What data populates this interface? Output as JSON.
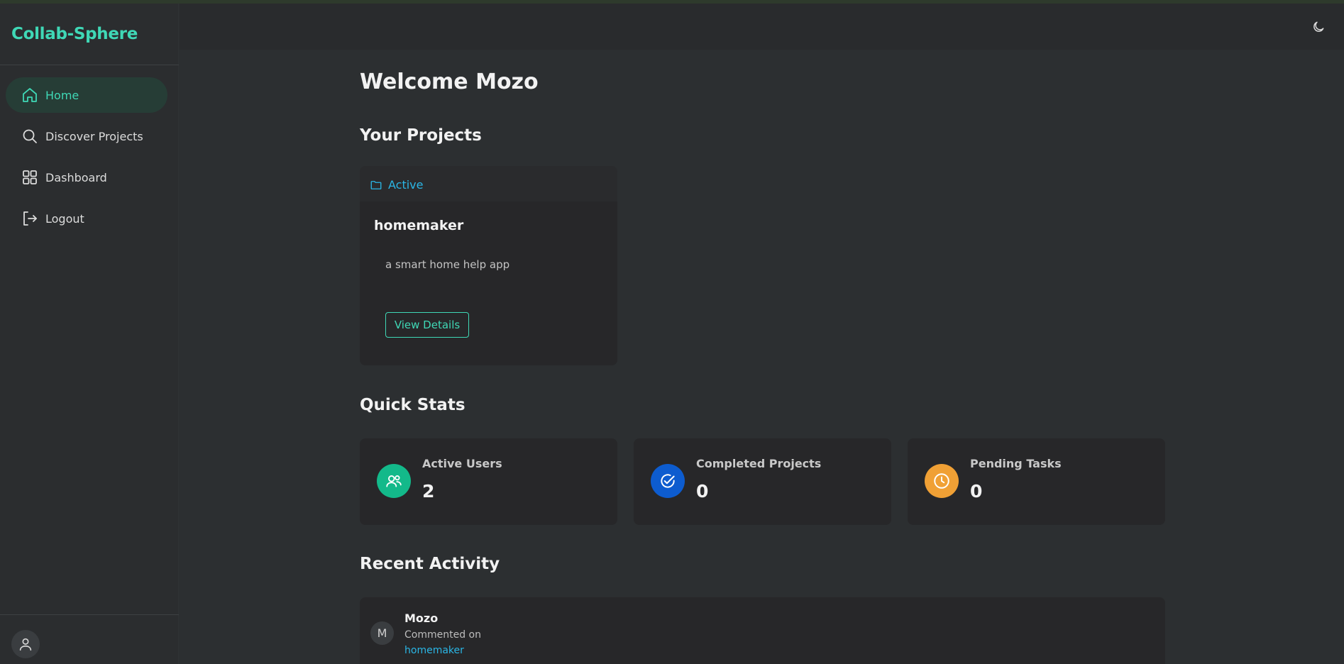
{
  "app": {
    "brand": "Collab-Sphere"
  },
  "sidebar": {
    "items": [
      {
        "label": "Home",
        "icon": "home-icon",
        "active": true
      },
      {
        "label": "Discover Projects",
        "icon": "search-icon",
        "active": false
      },
      {
        "label": "Dashboard",
        "icon": "grid-icon",
        "active": false
      },
      {
        "label": "Logout",
        "icon": "logout-icon",
        "active": false
      }
    ],
    "user_icon": "user-icon"
  },
  "header": {
    "theme_icon": "moon-icon"
  },
  "main": {
    "welcome": "Welcome Mozo",
    "projects_title": "Your Projects",
    "project": {
      "status": "Active",
      "name": "homemaker",
      "description": "a smart home help app",
      "button": "View Details"
    },
    "stats_title": "Quick Stats",
    "stats": [
      {
        "label": "Active Users",
        "value": "2",
        "color": "#13b98a",
        "icon": "users-icon"
      },
      {
        "label": "Completed Projects",
        "value": "0",
        "color": "#0d5ccf",
        "icon": "check-circle-icon"
      },
      {
        "label": "Pending Tasks",
        "value": "0",
        "color": "#f0a035",
        "icon": "clock-icon"
      }
    ],
    "activity_title": "Recent Activity",
    "activity": {
      "avatar": "M",
      "user": "Mozo",
      "action": "Commented on",
      "target": "homemaker"
    }
  },
  "colors": {
    "accent": "#3fd8b6",
    "link": "#2ab6e5",
    "background": "#2c2f31"
  }
}
